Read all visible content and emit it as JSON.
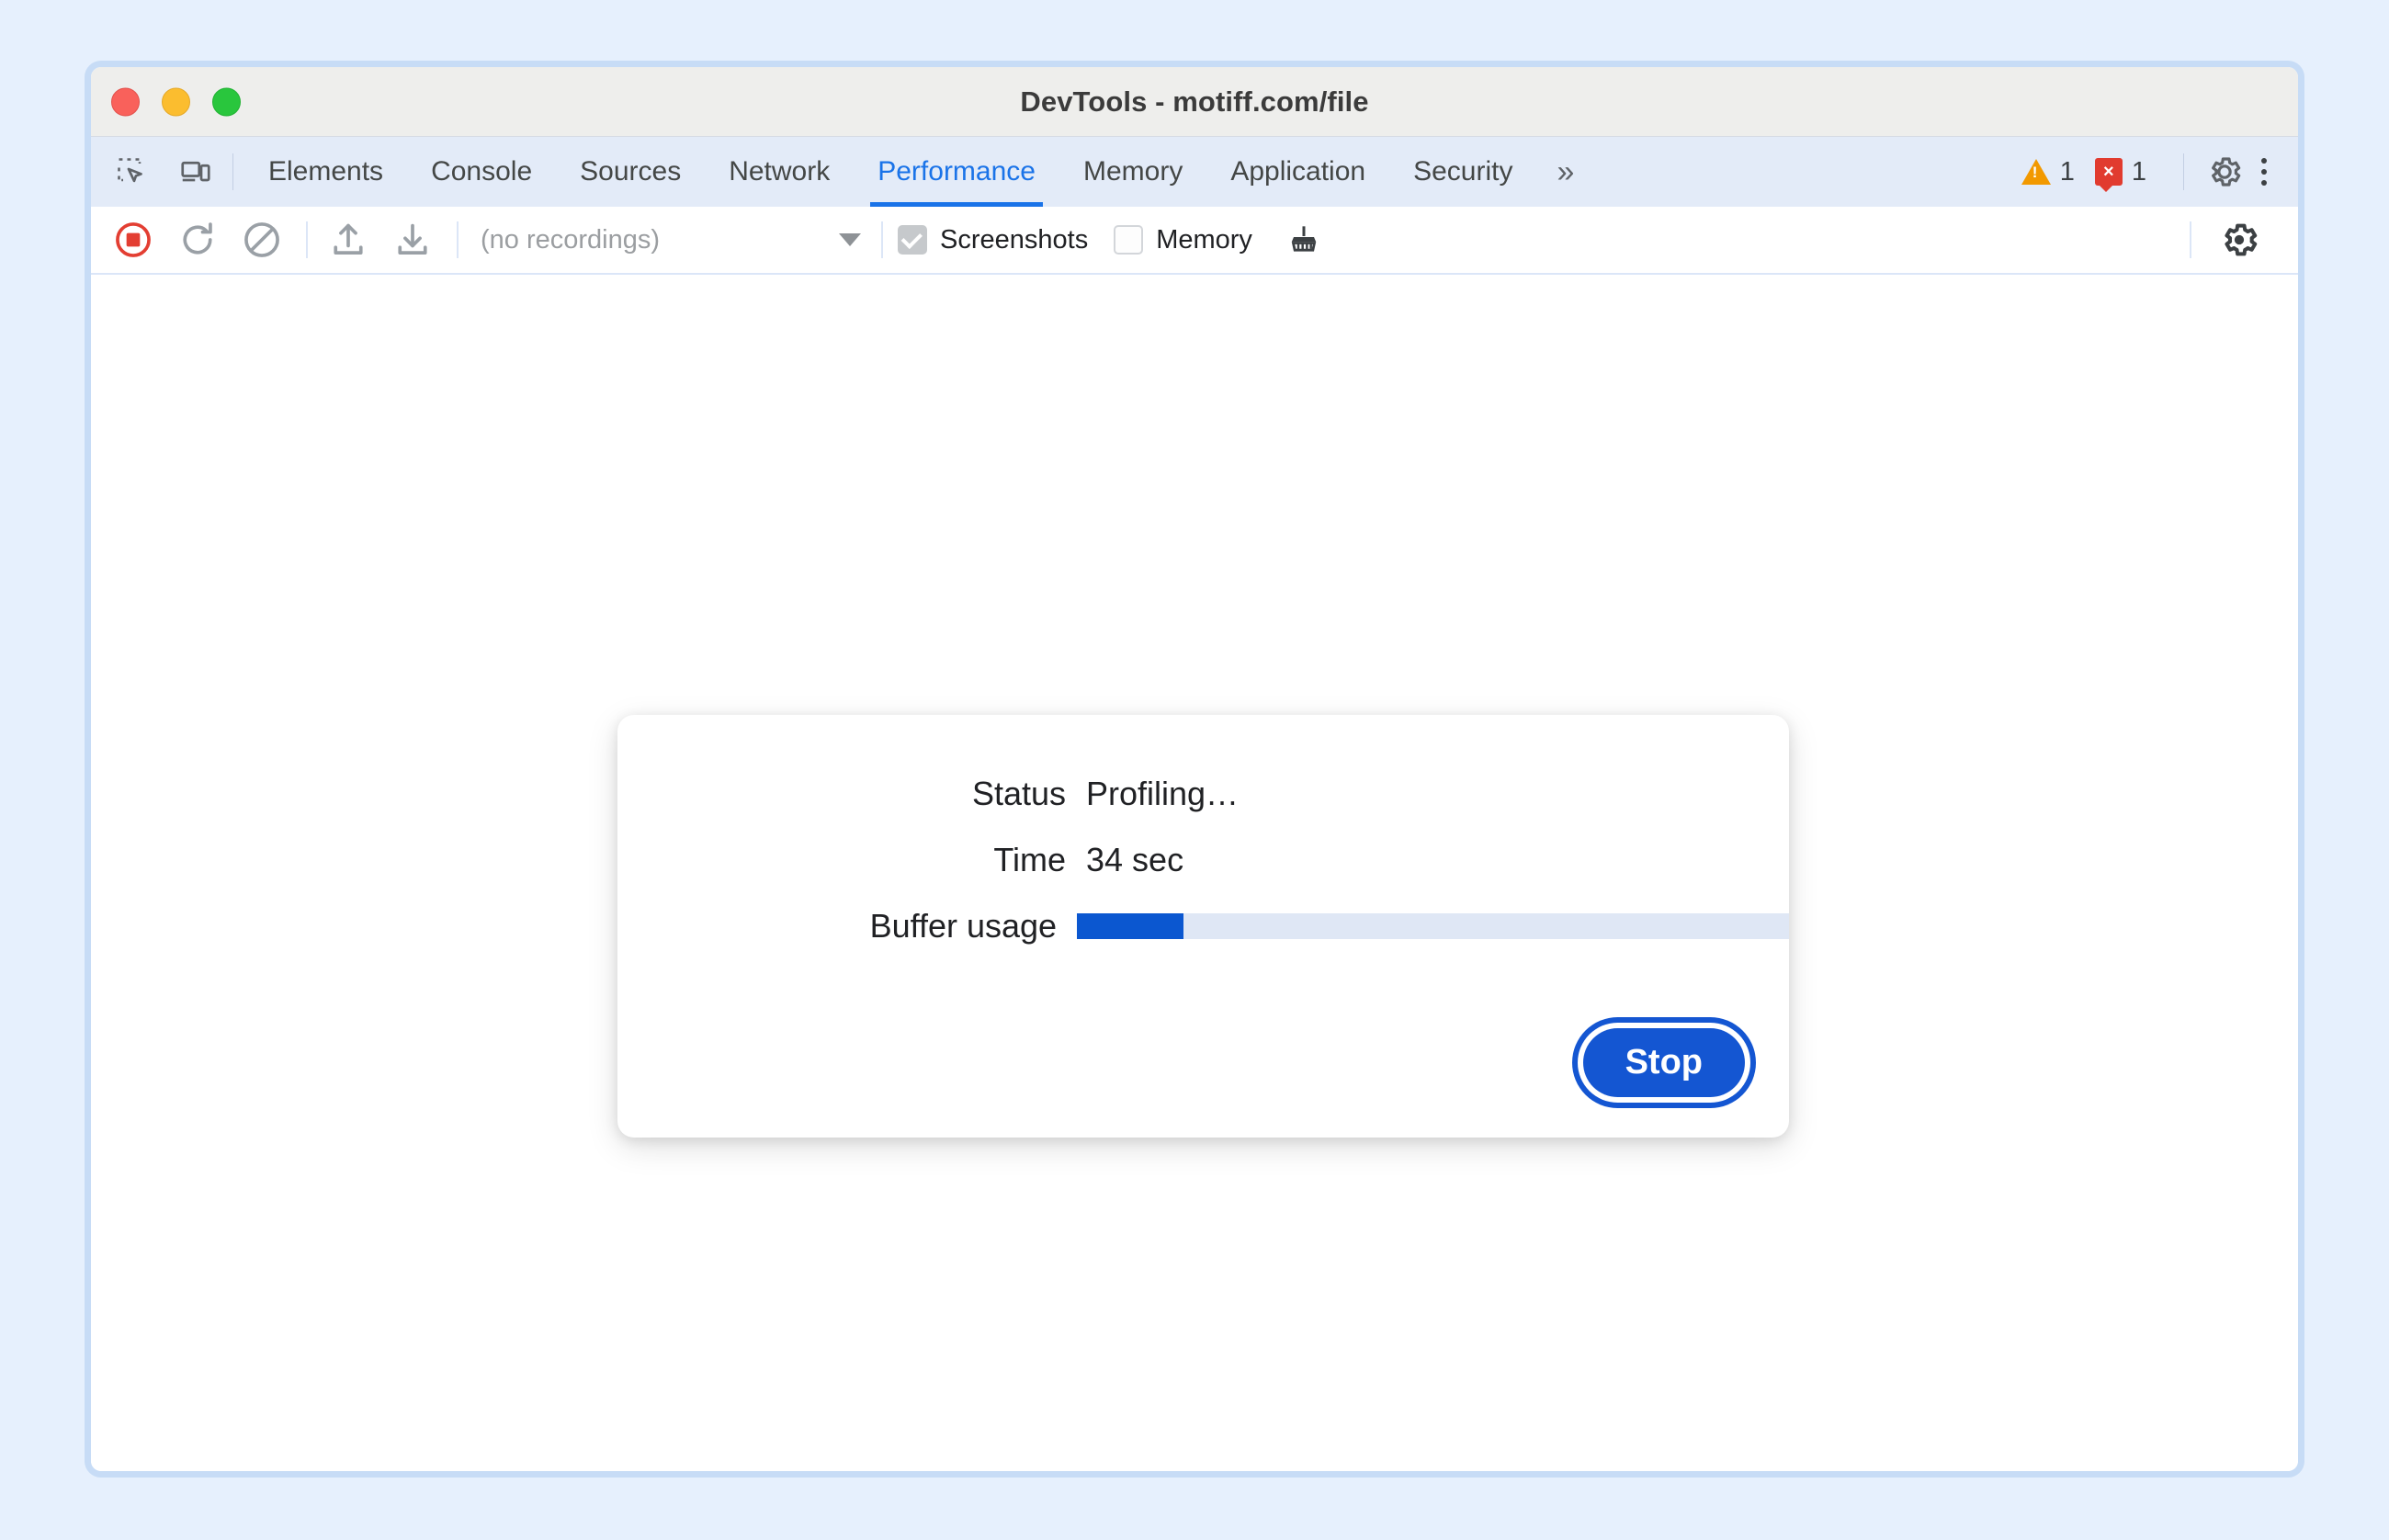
{
  "window": {
    "title": "DevTools - motiff.com/file",
    "traffic_lights": [
      {
        "name": "close",
        "color": "#f9615b"
      },
      {
        "name": "minimize",
        "color": "#fbbd2f"
      },
      {
        "name": "maximize",
        "color": "#29c63d"
      }
    ]
  },
  "tabbar": {
    "left_icons": [
      {
        "name": "inspect-element-icon",
        "label": "Inspect element"
      },
      {
        "name": "device-toolbar-icon",
        "label": "Toggle device toolbar"
      }
    ],
    "tabs": [
      {
        "label": "Elements",
        "active": false
      },
      {
        "label": "Console",
        "active": false
      },
      {
        "label": "Sources",
        "active": false
      },
      {
        "label": "Network",
        "active": false
      },
      {
        "label": "Performance",
        "active": true
      },
      {
        "label": "Memory",
        "active": false
      },
      {
        "label": "Application",
        "active": false
      },
      {
        "label": "Security",
        "active": false
      }
    ],
    "more_tabs_label": "»",
    "warning_count": "1",
    "error_count": "1",
    "error_glyph": "×",
    "settings_icon": "gear-icon",
    "menu_icon": "kebab-menu-icon",
    "active_tab_color": "#1a73e8"
  },
  "toolbar": {
    "buttons": [
      {
        "name": "record-button",
        "label": "Record"
      },
      {
        "name": "reload-and-record-button",
        "label": "Record and reload"
      },
      {
        "name": "clear-button",
        "label": "Clear"
      },
      {
        "name": "load-profile-button",
        "label": "Load profile"
      },
      {
        "name": "save-profile-button",
        "label": "Save profile"
      }
    ],
    "recordings_value": "(no recordings)",
    "screenshots_label": "Screenshots",
    "screenshots_checked": true,
    "memory_label": "Memory",
    "memory_checked": false,
    "collect_garbage_label": "Collect garbage",
    "capture_settings_label": "Capture settings"
  },
  "dialog": {
    "rows": [
      {
        "label": "Status",
        "value": "Profiling…",
        "type": "text"
      },
      {
        "label": "Time",
        "value": "34 sec",
        "type": "text"
      },
      {
        "label": "Buffer usage",
        "value": "",
        "type": "progress",
        "percent": 15
      }
    ],
    "stop_label": "Stop",
    "accent": "#1456d2",
    "progress_fill_color": "#0b57d0",
    "progress_track_color": "#dfe7f5"
  }
}
